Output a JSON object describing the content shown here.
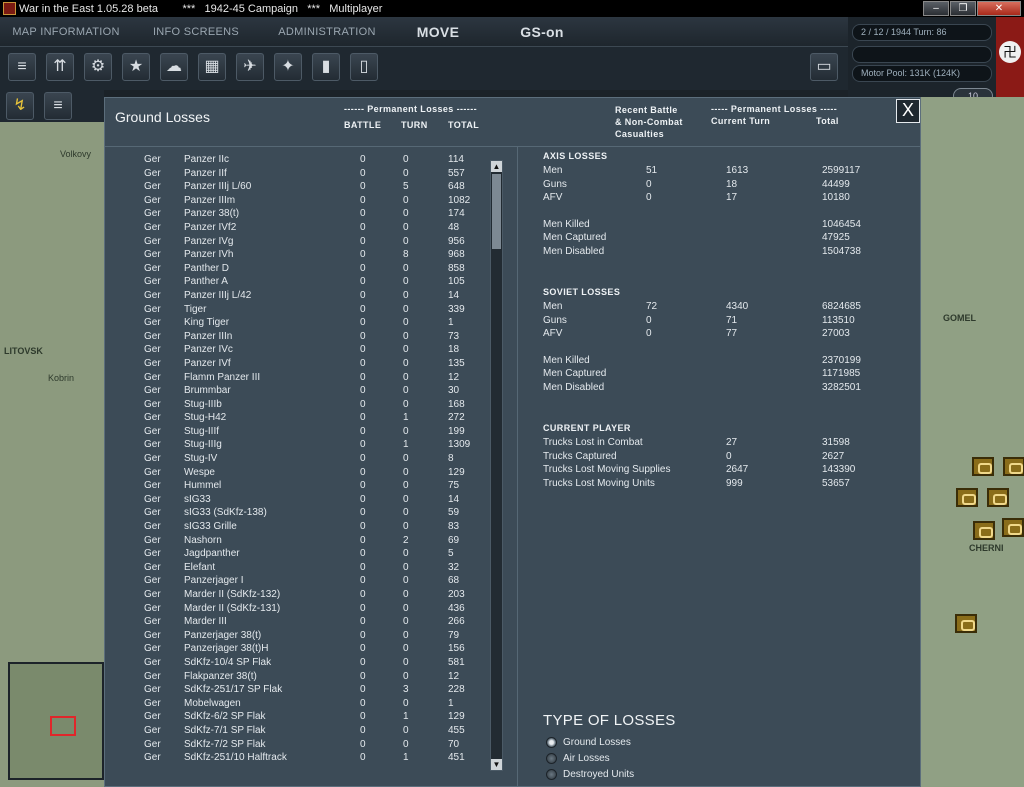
{
  "window": {
    "title": "War in the East 1.05.28 beta        ***   1942-45 Campaign   ***   Multiplayer",
    "buttons": [
      "–",
      "❐",
      "✕"
    ]
  },
  "topbar": {
    "tabs": [
      "MAP INFORMATION",
      "INFO SCREENS",
      "ADMINISTRATION",
      "MOVE",
      "GS-on"
    ]
  },
  "toolbar": {
    "icons": [
      "stack-icon",
      "units-icon",
      "gear-icon",
      "star-icon",
      "weather-icon",
      "grid-icon",
      "air-icon",
      "bomb-icon",
      "fuel-icon",
      "document-icon"
    ],
    "glyphs": [
      "≡",
      "⇈",
      "⚙",
      "★",
      "☁",
      "▦",
      "✈",
      "✦",
      "▮",
      "▯"
    ]
  },
  "status": {
    "date_turn": "2 / 12 / 1944     Turn: 86",
    "motor_pool": "Motor Pool:  131K (124K)",
    "pill_right": "10"
  },
  "map": {
    "labels_left": [
      "Volkovy",
      "LITOVSK",
      "Kobrin"
    ],
    "labels_right": [
      "GOMEL",
      "CHERNI"
    ]
  },
  "dialog": {
    "title": "Ground Losses",
    "close": "X",
    "left_header": {
      "group": "------ Permanent Losses ------",
      "battle": "BATTLE",
      "turn": "TURN",
      "total": "TOTAL"
    },
    "right_header": {
      "recent": "Recent Battle\n& Non-Combat\nCasualties",
      "group": "----- Permanent Losses -----",
      "current_turn": "Current Turn",
      "total": "Total"
    },
    "rows": [
      [
        "Ger",
        "Panzer IIc",
        "0",
        "0",
        "114"
      ],
      [
        "Ger",
        "Panzer IIf",
        "0",
        "0",
        "557"
      ],
      [
        "Ger",
        "Panzer IIIj L/60",
        "0",
        "5",
        "648"
      ],
      [
        "Ger",
        "Panzer IIIm",
        "0",
        "0",
        "1082"
      ],
      [
        "Ger",
        "Panzer 38(t)",
        "0",
        "0",
        "174"
      ],
      [
        "Ger",
        "Panzer IVf2",
        "0",
        "0",
        "48"
      ],
      [
        "Ger",
        "Panzer IVg",
        "0",
        "0",
        "956"
      ],
      [
        "Ger",
        "Panzer IVh",
        "0",
        "8",
        "968"
      ],
      [
        "Ger",
        "Panther D",
        "0",
        "0",
        "858"
      ],
      [
        "Ger",
        "Panther A",
        "0",
        "0",
        "105"
      ],
      [
        "Ger",
        "Panzer IIIj L/42",
        "0",
        "0",
        "14"
      ],
      [
        "Ger",
        "Tiger",
        "0",
        "0",
        "339"
      ],
      [
        "Ger",
        "King Tiger",
        "0",
        "0",
        "1"
      ],
      [
        "Ger",
        "Panzer IIIn",
        "0",
        "0",
        "73"
      ],
      [
        "Ger",
        "Panzer IVc",
        "0",
        "0",
        "18"
      ],
      [
        "Ger",
        "Panzer IVf",
        "0",
        "0",
        "135"
      ],
      [
        "Ger",
        "Flamm Panzer III",
        "0",
        "0",
        "12"
      ],
      [
        "Ger",
        "Brummbar",
        "0",
        "0",
        "30"
      ],
      [
        "Ger",
        "Stug-IIIb",
        "0",
        "0",
        "168"
      ],
      [
        "Ger",
        "Stug-H42",
        "0",
        "1",
        "272"
      ],
      [
        "Ger",
        "Stug-IIIf",
        "0",
        "0",
        "199"
      ],
      [
        "Ger",
        "Stug-IIIg",
        "0",
        "1",
        "1309"
      ],
      [
        "Ger",
        "Stug-IV",
        "0",
        "0",
        "8"
      ],
      [
        "Ger",
        "Wespe",
        "0",
        "0",
        "129"
      ],
      [
        "Ger",
        "Hummel",
        "0",
        "0",
        "75"
      ],
      [
        "Ger",
        "sIG33",
        "0",
        "0",
        "14"
      ],
      [
        "Ger",
        "sIG33 (SdKfz-138)",
        "0",
        "0",
        "59"
      ],
      [
        "Ger",
        "sIG33 Grille",
        "0",
        "0",
        "83"
      ],
      [
        "Ger",
        "Nashorn",
        "0",
        "2",
        "69"
      ],
      [
        "Ger",
        "Jagdpanther",
        "0",
        "0",
        "5"
      ],
      [
        "Ger",
        "Elefant",
        "0",
        "0",
        "32"
      ],
      [
        "Ger",
        "Panzerjager I",
        "0",
        "0",
        "68"
      ],
      [
        "Ger",
        "Marder II (SdKfz-132)",
        "0",
        "0",
        "203"
      ],
      [
        "Ger",
        "Marder II (SdKfz-131)",
        "0",
        "0",
        "436"
      ],
      [
        "Ger",
        "Marder III",
        "0",
        "0",
        "266"
      ],
      [
        "Ger",
        "Panzerjager 38(t)",
        "0",
        "0",
        "79"
      ],
      [
        "Ger",
        "Panzerjager 38(t)H",
        "0",
        "0",
        "156"
      ],
      [
        "Ger",
        "SdKfz-10/4 SP Flak",
        "0",
        "0",
        "581"
      ],
      [
        "Ger",
        "Flakpanzer 38(t)",
        "0",
        "0",
        "12"
      ],
      [
        "Ger",
        "SdKfz-251/17 SP Flak",
        "0",
        "3",
        "228"
      ],
      [
        "Ger",
        "Mobelwagen",
        "0",
        "0",
        "1"
      ],
      [
        "Ger",
        "SdKfz-6/2 SP Flak",
        "0",
        "1",
        "129"
      ],
      [
        "Ger",
        "SdKfz-7/1 SP Flak",
        "0",
        "0",
        "455"
      ],
      [
        "Ger",
        "SdKfz-7/2 SP Flak",
        "0",
        "0",
        "70"
      ],
      [
        "Ger",
        "SdKfz-251/10 Halftrack",
        "0",
        "1",
        "451"
      ]
    ],
    "axis": {
      "title": "AXIS LOSSES",
      "rows": [
        [
          "Men",
          "51",
          "1613",
          "2599117"
        ],
        [
          "Guns",
          "0",
          "18",
          "44499"
        ],
        [
          "AFV",
          "0",
          "17",
          "10180"
        ]
      ],
      "extra": [
        [
          "Men Killed",
          "1046454"
        ],
        [
          "Men Captured",
          "47925"
        ],
        [
          "Men Disabled",
          "1504738"
        ]
      ]
    },
    "soviet": {
      "title": "SOVIET LOSSES",
      "rows": [
        [
          "Men",
          "72",
          "4340",
          "6824685"
        ],
        [
          "Guns",
          "0",
          "71",
          "113510"
        ],
        [
          "AFV",
          "0",
          "77",
          "27003"
        ]
      ],
      "extra": [
        [
          "Men Killed",
          "2370199"
        ],
        [
          "Men Captured",
          "1171985"
        ],
        [
          "Men Disabled",
          "3282501"
        ]
      ]
    },
    "player": {
      "title": "CURRENT PLAYER",
      "rows": [
        [
          "Trucks Lost in Combat",
          "27",
          "31598"
        ],
        [
          "Trucks Captured",
          "0",
          "2627"
        ],
        [
          "Trucks Lost Moving Supplies",
          "2647",
          "143390"
        ],
        [
          "Trucks Lost Moving Units",
          "999",
          "53657"
        ]
      ]
    },
    "type_of_losses": {
      "title": "TYPE OF LOSSES",
      "options": [
        "Ground Losses",
        "Air Losses",
        "Destroyed Units"
      ],
      "selected": 0
    }
  }
}
